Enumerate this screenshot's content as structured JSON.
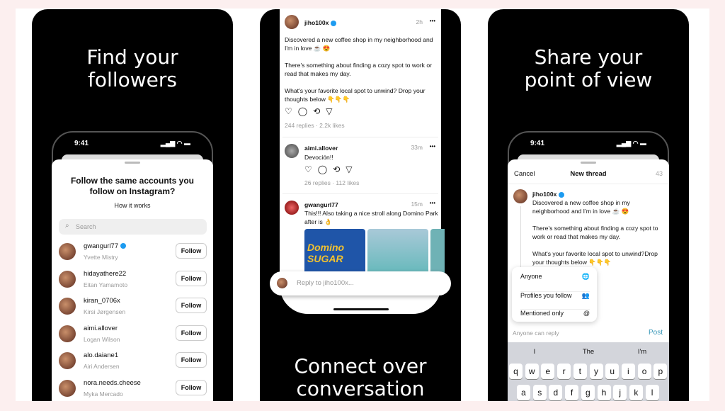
{
  "colors": {
    "background": "#fcefef",
    "panel": "#000000",
    "accent": "#1d9bf0",
    "post_blue": "#3897b8"
  },
  "panel1": {
    "title_line1": "Find your",
    "title_line2": "followers",
    "status_time": "9:41",
    "heading_line1": "Follow the same accounts you",
    "heading_line2": "follow on Instagram?",
    "how_it_works": "How it works",
    "search_placeholder": "Search",
    "follow_label": "Follow",
    "accounts": [
      {
        "username": "gwangurl77",
        "name": "Yvette Mistry",
        "verified": true
      },
      {
        "username": "hidayathere22",
        "name": "Eitan Yamamoto"
      },
      {
        "username": "kiran_0706x",
        "name": "Kirsi Jørgensen"
      },
      {
        "username": "aimi.allover",
        "name": "Logan Wilson"
      },
      {
        "username": "alo.daiane1",
        "name": "Airi Andersen"
      },
      {
        "username": "nora.needs.cheese",
        "name": "Myka Mercado"
      }
    ]
  },
  "panel2": {
    "posts": [
      {
        "username": "jiho100x",
        "time": "2h",
        "p1": "Discovered a new coffee shop in my neighborhood and I'm in love ☕ 😍",
        "p2": "There's something about finding a cozy spot to work or read that makes my day.",
        "p3": "What's your favorite local spot to unwind? Drop your thoughts below 👇👇👇",
        "stats": "244 replies · 2.2k likes"
      },
      {
        "username": "aimi.allover",
        "time": "33m",
        "text": "Devoción!!",
        "stats": "26 replies · 112 likes"
      },
      {
        "username": "gwangurl77",
        "time": "15m",
        "text": "This!!! Also taking a nice stroll along Domino Park after is 👌",
        "image_text": "Domino SUGAR"
      }
    ],
    "more": "•••",
    "reply_placeholder": "Reply to jiho100x...",
    "caption_line1": "Connect over",
    "caption_line2": "conversation"
  },
  "panel3": {
    "title_line1": "Share your",
    "title_line2": "point of view",
    "status_time": "9:41",
    "cancel": "Cancel",
    "header": "New thread",
    "count": "43",
    "username": "jiho100x",
    "p1": "Discovered a new coffee shop in my neighborhood and I'm in love ☕ 😍",
    "p2": "There's something about finding a cozy spot to work or read that makes my day.",
    "p3": "What's your favorite local spot to unwind?Drop your thoughts below 👇👇👇",
    "menu": [
      {
        "label": "Anyone",
        "icon": "globe-icon",
        "glyph": "🌐"
      },
      {
        "label": "Profiles you follow",
        "icon": "people-icon",
        "glyph": "👥"
      },
      {
        "label": "Mentioned only",
        "icon": "at-icon",
        "glyph": "@"
      }
    ],
    "reply_setting": "Anyone can reply",
    "post": "Post",
    "suggestions": [
      "I",
      "The",
      "I'm"
    ],
    "row1": [
      "q",
      "w",
      "e",
      "r",
      "t",
      "y",
      "u",
      "i",
      "o",
      "p"
    ],
    "row2": [
      "a",
      "s",
      "d",
      "f",
      "g",
      "h",
      "j",
      "k",
      "l"
    ]
  }
}
